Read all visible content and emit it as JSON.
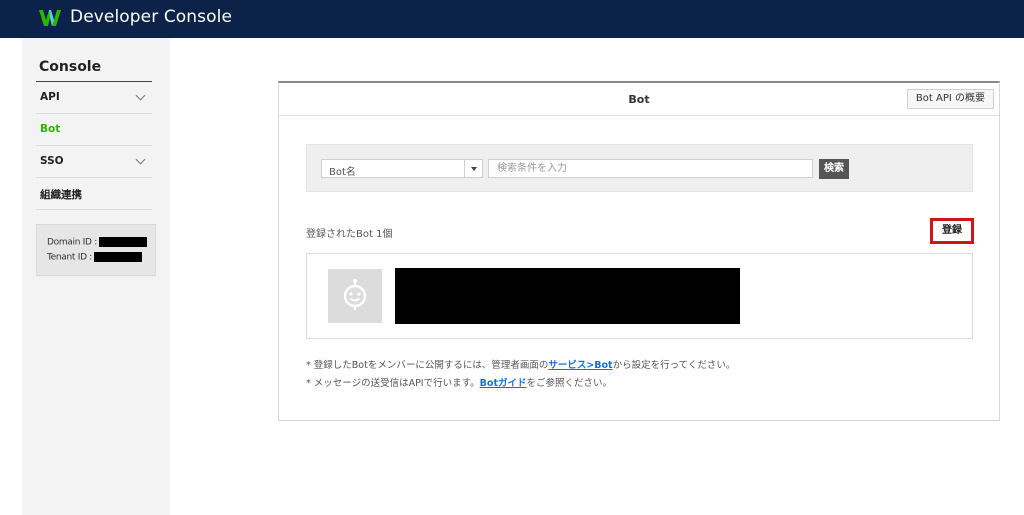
{
  "header": {
    "app_title": "Developer Console",
    "logo_icon": "works-logo-icon",
    "logo_color": "#2db400"
  },
  "sidebar": {
    "title": "Console",
    "items": [
      {
        "label": "API",
        "expandable": true,
        "active": false
      },
      {
        "label": "Bot",
        "expandable": false,
        "active": true
      },
      {
        "label": "SSO",
        "expandable": true,
        "active": false
      },
      {
        "label": "組織連携",
        "expandable": false,
        "active": false
      }
    ],
    "id_box": {
      "domain_label": "Domain ID :",
      "tenant_label": "Tenant ID :"
    }
  },
  "main": {
    "title": "Bot",
    "api_overview_button": "Bot API の概要",
    "search": {
      "select_value": "Bot名",
      "input_placeholder": "検索条件を入力",
      "search_button": "検索"
    },
    "count_label": "登録されたBot 1個",
    "register_button": "登録",
    "notes": [
      {
        "before": "* 登録したBotをメンバーに公開するには、管理者画面の",
        "link": "サービス>Bot",
        "after": "から設定を行ってください。"
      },
      {
        "before": "* メッセージの送受信はAPIで行います。",
        "link": "Botガイド",
        "after": "をご参照ください。"
      }
    ]
  },
  "colors": {
    "header_bg": "#0c2248",
    "active_nav": "#2db400",
    "link": "#1a6ecf",
    "highlight": "#d0141e"
  }
}
